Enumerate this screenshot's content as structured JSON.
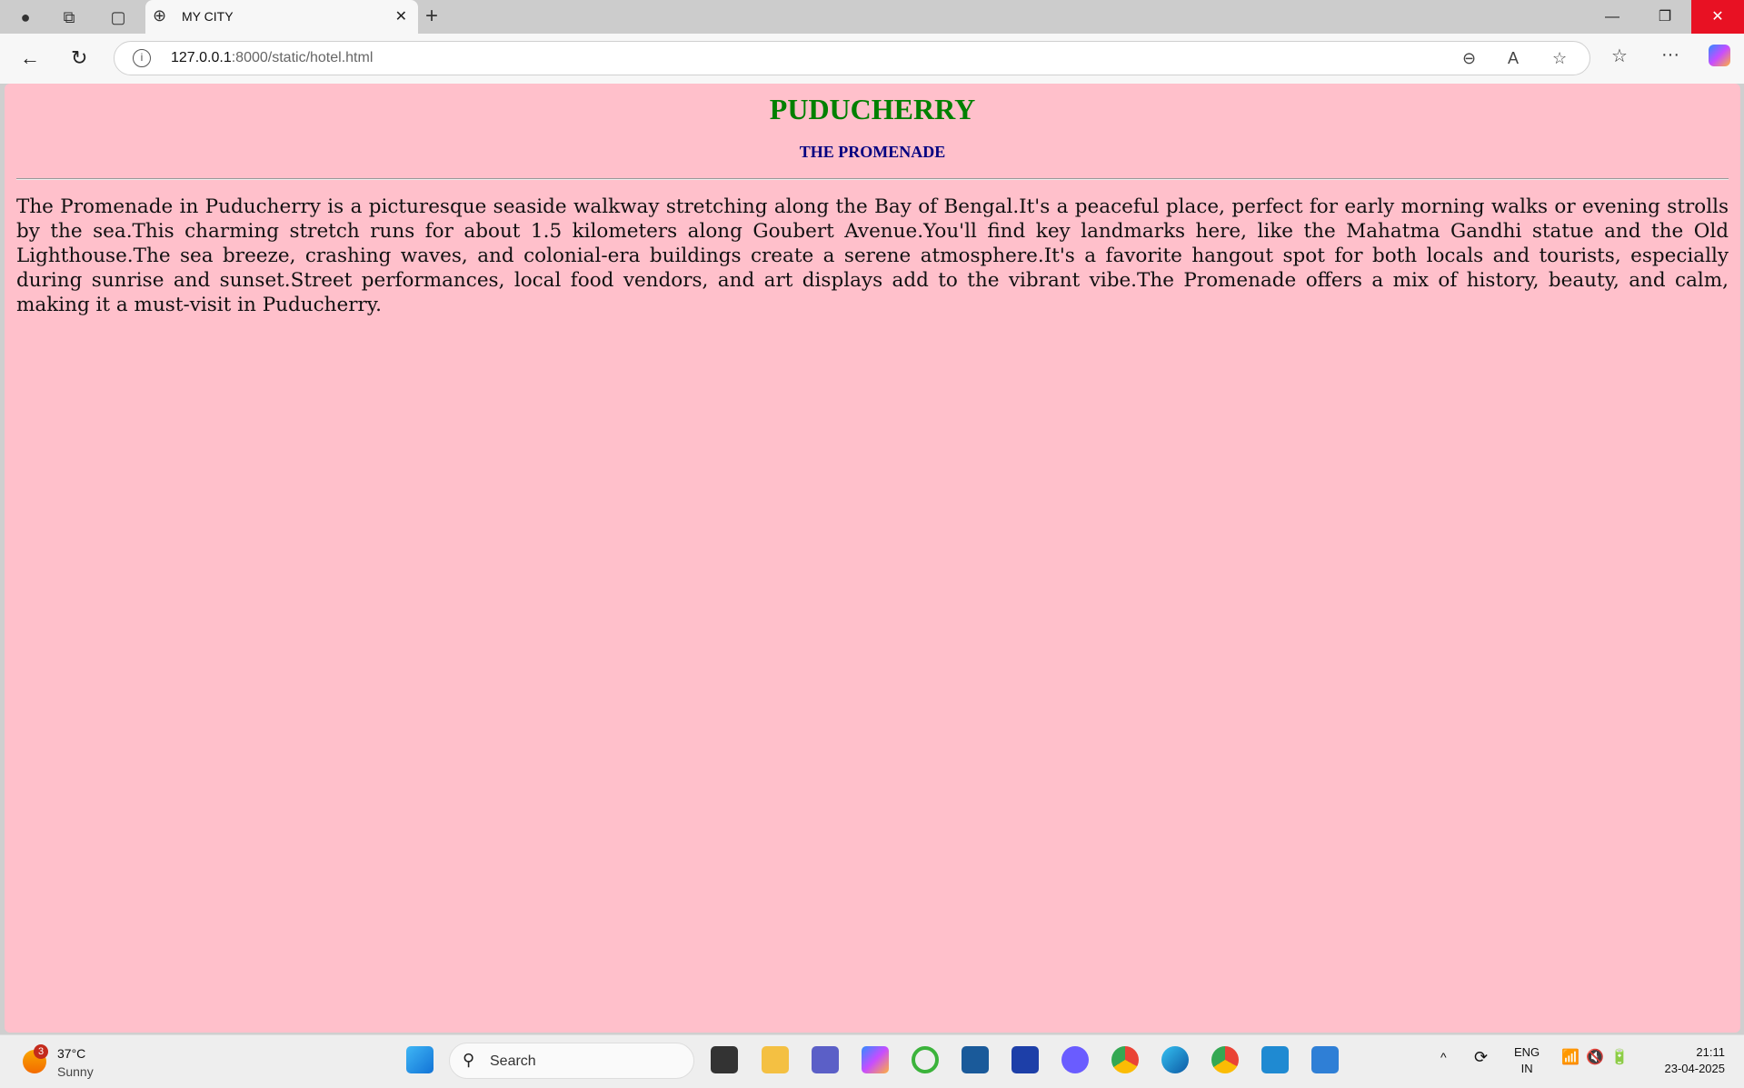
{
  "browser": {
    "tab_title": "MY CITY",
    "url_host": "127.0.0.1",
    "url_rest": ":8000/static/hotel.html"
  },
  "page": {
    "title": "PUDUCHERRY",
    "subtitle": "THE PROMENADE",
    "paragraph": "The Promenade in Puducherry is a picturesque seaside walkway stretching along the Bay of Bengal.It's a peaceful place, perfect for early morning walks or evening strolls by the sea.This charming stretch runs for about 1.5 kilometers along Goubert Avenue.You'll find key landmarks here, like the Mahatma Gandhi statue and the Old Lighthouse.The sea breeze, crashing waves, and colonial-era buildings create a serene atmosphere.It's a favorite hangout spot for both locals and tourists, especially during sunrise and sunset.Street performances, local food vendors, and art displays add to the vibrant vibe.The Promenade offers a mix of history, beauty, and calm, making it a must-visit in Puducherry."
  },
  "taskbar": {
    "weather_badge": "3",
    "temperature": "37°C",
    "condition": "Sunny",
    "search_label": "Search",
    "lang1": "ENG",
    "lang2": "IN",
    "time": "21:11",
    "date": "23-04-2025"
  },
  "colors": {
    "page_bg": "#ffc0cb",
    "title": "#008000",
    "subtitle": "#000080"
  }
}
